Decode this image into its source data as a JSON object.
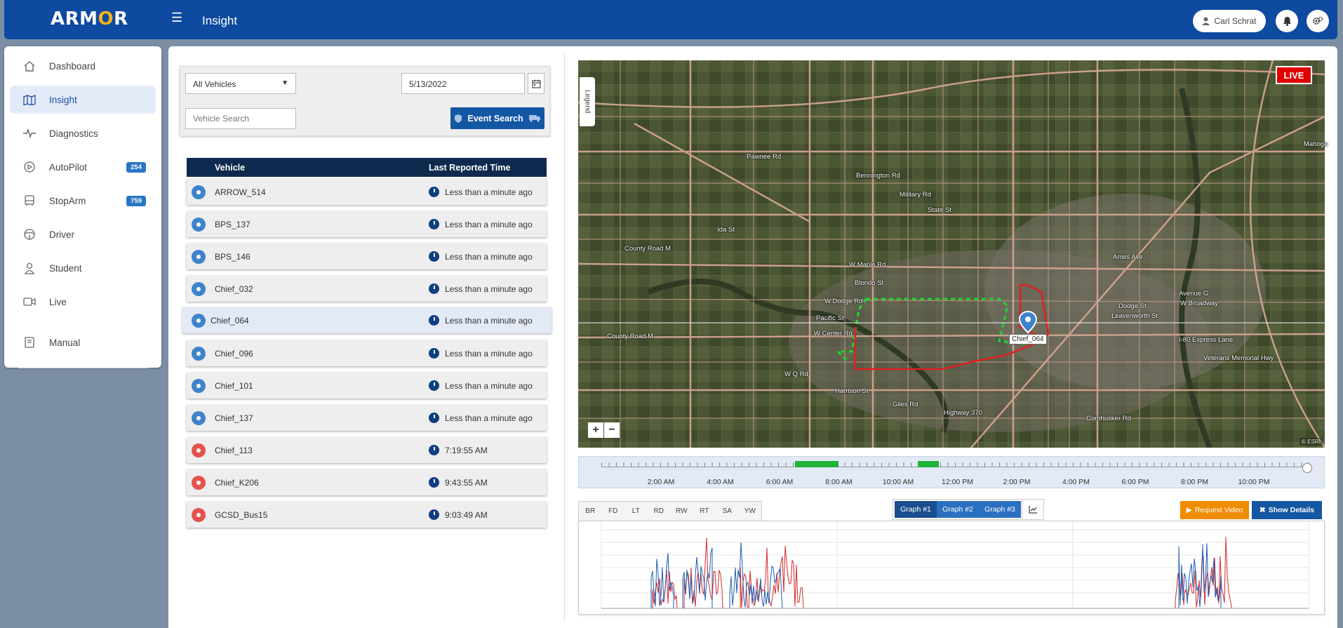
{
  "header": {
    "logo": "ARM",
    "logo_o": "O",
    "logo_end": "R",
    "title": "Insight",
    "user_name": "Carl Schrat"
  },
  "sidebar": {
    "items": [
      {
        "label": "Dashboard",
        "icon": "home-icon"
      },
      {
        "label": "Insight",
        "icon": "map-icon",
        "active": true
      },
      {
        "label": "Diagnostics",
        "icon": "pulse-icon"
      },
      {
        "label": "AutoPilot",
        "icon": "play-icon",
        "badge": "254"
      },
      {
        "label": "StopArm",
        "icon": "bus-icon",
        "badge": "759"
      },
      {
        "label": "Driver",
        "icon": "steering-wheel-icon"
      },
      {
        "label": "Student",
        "icon": "student-icon"
      },
      {
        "label": "Live",
        "icon": "video-camera-icon"
      },
      {
        "label": "Manual",
        "icon": "book-icon"
      }
    ]
  },
  "filters": {
    "vehicle_select": "All Vehicles",
    "date": "5/13/2022",
    "search_placeholder": "Vehicle Search",
    "event_search": "Event Search"
  },
  "vehicle_table": {
    "headers": [
      "Vehicle",
      "Last Reported Time"
    ],
    "rows": [
      {
        "name": "ARROW_514",
        "time": "Less than a minute ago",
        "status": "online"
      },
      {
        "name": "BPS_137",
        "time": "Less than a minute ago",
        "status": "online"
      },
      {
        "name": "BPS_146",
        "time": "Less than a minute ago",
        "status": "online"
      },
      {
        "name": "Chief_032",
        "time": "Less than a minute ago",
        "status": "online"
      },
      {
        "name": "Chief_064",
        "time": "Less than a minute ago",
        "status": "online",
        "selected": true
      },
      {
        "name": "Chief_096",
        "time": "Less than a minute ago",
        "status": "online"
      },
      {
        "name": "Chief_101",
        "time": "Less than a minute ago",
        "status": "online"
      },
      {
        "name": "Chief_137",
        "time": "Less than a minute ago",
        "status": "online"
      },
      {
        "name": "Chief_113",
        "time": "7:19:55 AM",
        "status": "offline"
      },
      {
        "name": "Chief_K206",
        "time": "9:43:55 AM",
        "status": "offline"
      },
      {
        "name": "GCSD_Bus15",
        "time": "9:03:49 AM",
        "status": "offline"
      }
    ]
  },
  "colors": {
    "online": "#3f83cc",
    "offline": "#e5534b",
    "primary": "#1457a3",
    "header": "#0d4aa0"
  },
  "map": {
    "live": "LIVE",
    "legend": "Legend",
    "zoom_in": "+",
    "zoom_out": "−",
    "attribution": "© ESRI",
    "vehicle_label": "Chief_064",
    "place_labels": [
      {
        "text": "Pawnee Rd"
      },
      {
        "text": "Bennington Rd"
      },
      {
        "text": "State St"
      },
      {
        "text": "Military Rd"
      },
      {
        "text": "Ida St"
      },
      {
        "text": "County Road M"
      },
      {
        "text": "W Maple Rd"
      },
      {
        "text": "Blondo St"
      },
      {
        "text": "W Dodge Rd"
      },
      {
        "text": "Pacific St"
      },
      {
        "text": "W Center Rd"
      },
      {
        "text": "County Road M"
      },
      {
        "text": "W Q Rd"
      },
      {
        "text": "Harrison St"
      },
      {
        "text": "Giles Rd"
      },
      {
        "text": "Highway 370"
      },
      {
        "text": "Cornhusker Rd"
      },
      {
        "text": "Avenue G"
      },
      {
        "text": "W Broadway"
      },
      {
        "text": "I-80 Express Lane"
      },
      {
        "text": "Veterans Memorial Hwy"
      },
      {
        "text": "Ames Ave"
      },
      {
        "text": "Dodge St"
      },
      {
        "text": "Leavenworth St"
      },
      {
        "text": "Mahoga"
      }
    ]
  },
  "timeline": {
    "labels": [
      "2:00 AM",
      "4:00 AM",
      "6:00 AM",
      "8:00 AM",
      "10:00 AM",
      "12:00 PM",
      "2:00 PM",
      "4:00 PM",
      "6:00 PM",
      "8:00 PM",
      "10:00 PM"
    ]
  },
  "graph": {
    "sensor_tabs": [
      "BR",
      "FD",
      "LT",
      "RD",
      "RW",
      "RT",
      "SA",
      "YW"
    ],
    "graph_buttons": [
      "Graph #1",
      "Graph #2",
      "Graph #3"
    ],
    "active_graph": "Graph #1",
    "request_video": "Request Video",
    "show_details": "Show Details"
  }
}
